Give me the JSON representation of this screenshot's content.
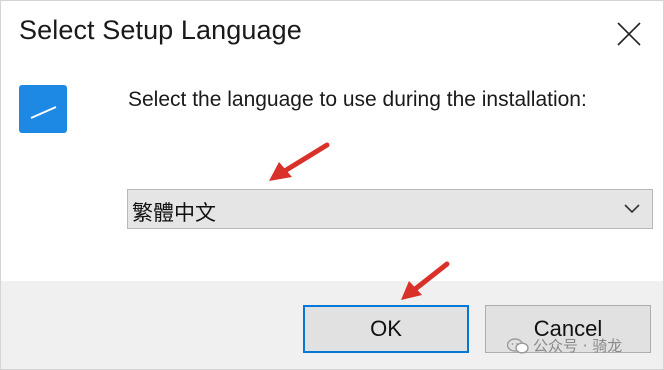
{
  "window": {
    "title": "Select Setup Language"
  },
  "body": {
    "prompt": "Select the language to use during the installation:",
    "language_select": {
      "value": "繁體中文"
    }
  },
  "buttons": {
    "ok_label": "OK",
    "cancel_label": "Cancel"
  },
  "watermark": {
    "text": "公众号 · 骑龙"
  },
  "icons": {
    "close": "close-icon",
    "app": "setup-app-icon",
    "dropdown": "chevron-down-icon",
    "annotation": "red-arrow-icon"
  },
  "colors": {
    "accent": "#0078d7",
    "app_icon": "#1e88e5",
    "annotation_arrow": "#d9302a",
    "footer_bg": "#f0f0f0",
    "select_bg": "#e5e5e5"
  }
}
